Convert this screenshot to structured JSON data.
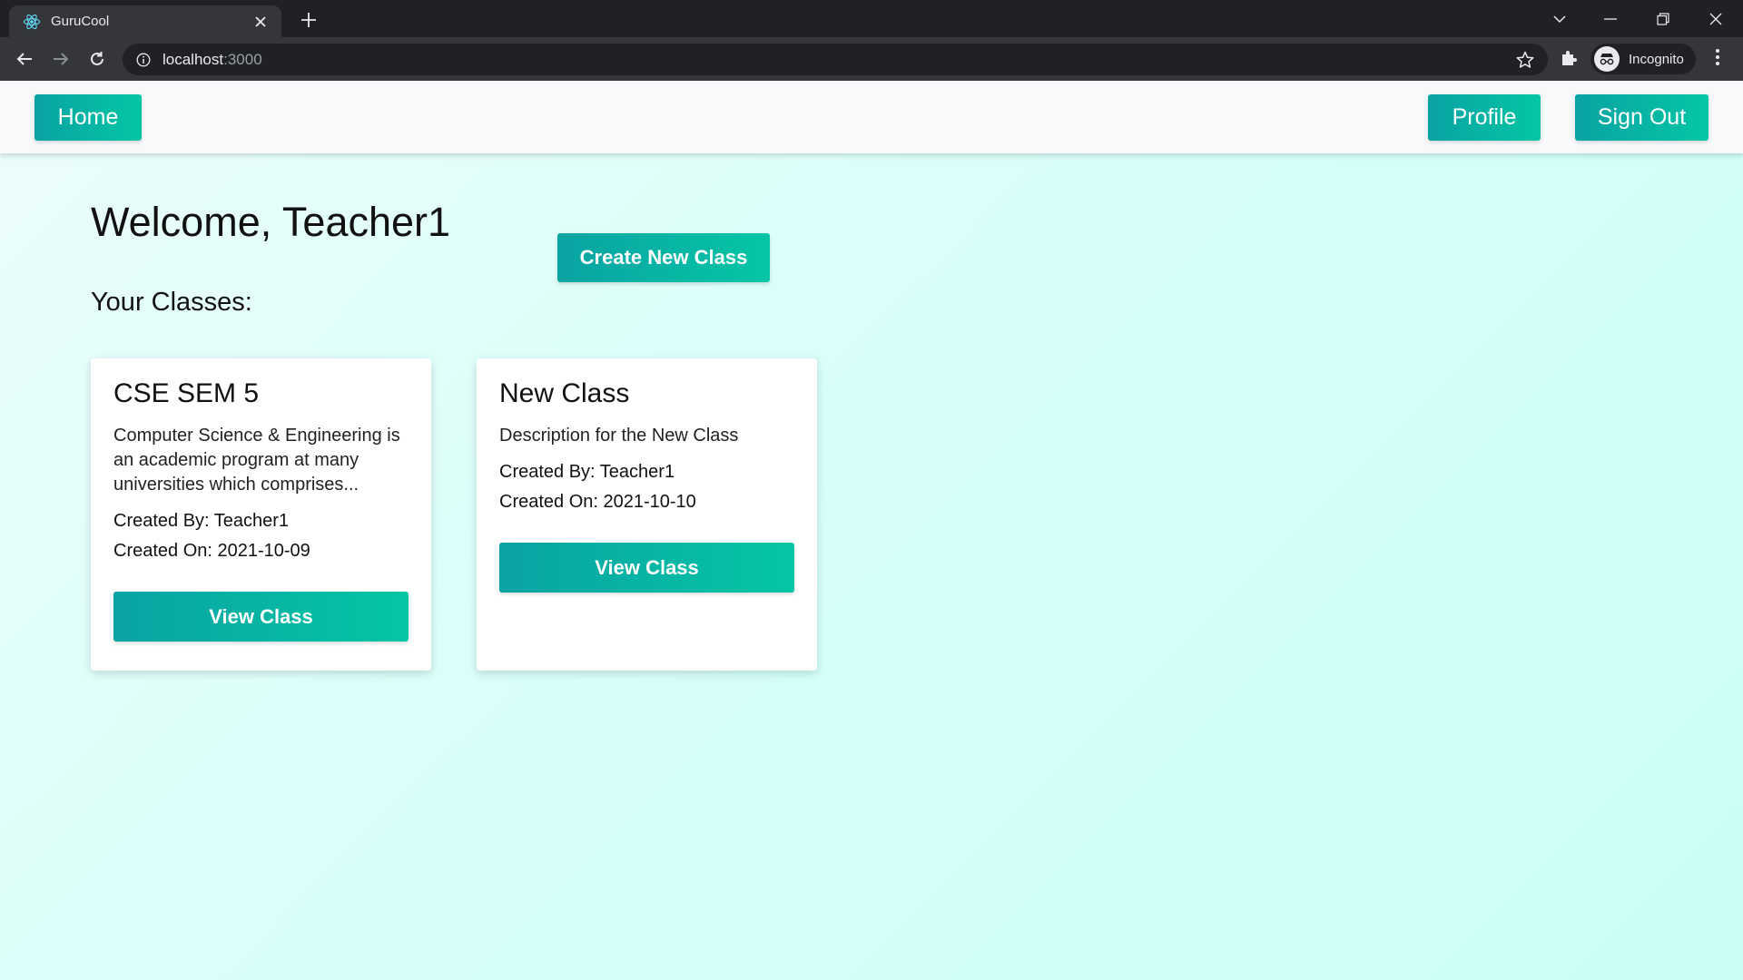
{
  "browser": {
    "tab_title": "GuruCool",
    "url_host": "localhost",
    "url_port": ":3000",
    "profile_label": "Incognito"
  },
  "navbar": {
    "home_label": "Home",
    "profile_label": "Profile",
    "signout_label": "Sign Out"
  },
  "main": {
    "welcome": "Welcome, Teacher1",
    "create_label": "Create New Class",
    "classes_heading": "Your Classes:"
  },
  "classes": [
    {
      "title": "CSE SEM 5",
      "description": "Computer Science & Engineering is an academic program at many universities which comprises...",
      "created_by": "Created By: Teacher1",
      "created_on": "Created On: 2021-10-09",
      "button_label": "View Class"
    },
    {
      "title": "New Class",
      "description": "Description for the New Class",
      "created_by": "Created By: Teacher1",
      "created_on": "Created On: 2021-10-10",
      "button_label": "View Class"
    }
  ],
  "colors": {
    "accent_start": "#0aa3a3",
    "accent_end": "#04c6a5",
    "page_bg": "#d4fff9"
  }
}
